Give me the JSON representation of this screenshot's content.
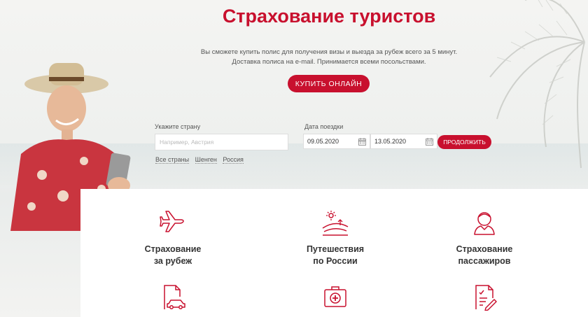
{
  "hero": {
    "title": "Страхование туристов",
    "subtitle_line1": "Вы сможете купить полис для получения визы и выезда за рубеж всего за 5 минут.",
    "subtitle_line2": "Доставка полиса на e-mail. Принимается всеми посольствами.",
    "buy_label": "Купить онлайн"
  },
  "form": {
    "country_label": "Укажите страну",
    "country_placeholder": "Например, Австрия",
    "date_label": "Дата поездки",
    "date_from": "09.05.2020",
    "date_separator": "—",
    "date_to": "13.05.2020",
    "continue_label": "Продолжить",
    "quick_links": [
      "Все страны",
      "Шенген",
      "Россия"
    ]
  },
  "services": [
    {
      "line1": "Страхование",
      "line2": "за рубеж",
      "icon": "airplane-icon"
    },
    {
      "line1": "Путешествия",
      "line2": "по России",
      "icon": "landscape-icon"
    },
    {
      "line1": "Страхование",
      "line2": "пассажиров",
      "icon": "passenger-icon"
    },
    {
      "icon": "car-document-icon"
    },
    {
      "icon": "medical-kit-icon"
    },
    {
      "icon": "contract-pen-icon"
    }
  ],
  "colors": {
    "accent": "#c8102e",
    "text": "#333333",
    "background": "#f1f2f0"
  }
}
